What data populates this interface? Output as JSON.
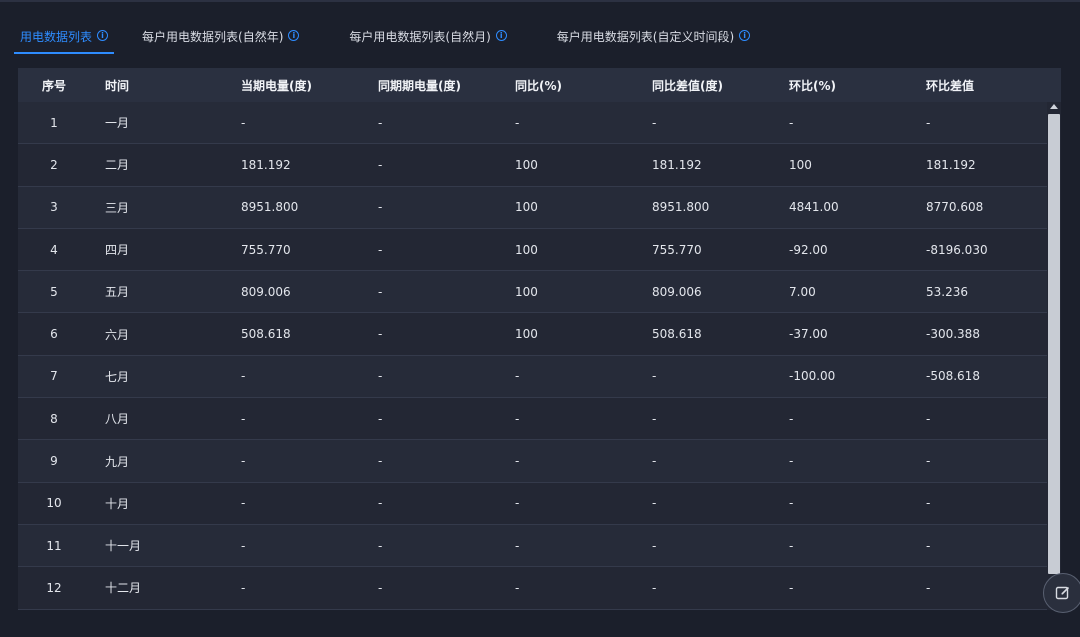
{
  "tabs": [
    {
      "label": "用电数据列表",
      "active": true
    },
    {
      "label": "每户用电数据列表(自然年)",
      "active": false
    },
    {
      "label": "每户用电数据列表(自然月)",
      "active": false
    },
    {
      "label": "每户用电数据列表(自定义时间段)",
      "active": false
    }
  ],
  "table": {
    "columns": [
      "序号",
      "时间",
      "当期电量(度)",
      "同期期电量(度)",
      "同比(%)",
      "同比差值(度)",
      "环比(%)",
      "环比差值"
    ],
    "rows": [
      [
        "1",
        "一月",
        "-",
        "-",
        "-",
        "-",
        "-",
        "-"
      ],
      [
        "2",
        "二月",
        "181.192",
        "-",
        "100",
        "181.192",
        "100",
        "181.192"
      ],
      [
        "3",
        "三月",
        "8951.800",
        "-",
        "100",
        "8951.800",
        "4841.00",
        "8770.608"
      ],
      [
        "4",
        "四月",
        "755.770",
        "-",
        "100",
        "755.770",
        "-92.00",
        "-8196.030"
      ],
      [
        "5",
        "五月",
        "809.006",
        "-",
        "100",
        "809.006",
        "7.00",
        "53.236"
      ],
      [
        "6",
        "六月",
        "508.618",
        "-",
        "100",
        "508.618",
        "-37.00",
        "-300.388"
      ],
      [
        "7",
        "七月",
        "-",
        "-",
        "-",
        "-",
        "-100.00",
        "-508.618"
      ],
      [
        "8",
        "八月",
        "-",
        "-",
        "-",
        "-",
        "-",
        "-"
      ],
      [
        "9",
        "九月",
        "-",
        "-",
        "-",
        "-",
        "-",
        "-"
      ],
      [
        "10",
        "十月",
        "-",
        "-",
        "-",
        "-",
        "-",
        "-"
      ],
      [
        "11",
        "十一月",
        "-",
        "-",
        "-",
        "-",
        "-",
        "-"
      ],
      [
        "12",
        "十二月",
        "-",
        "-",
        "-",
        "-",
        "-",
        "-"
      ]
    ]
  },
  "colors": {
    "accent": "#2e8cff",
    "background": "#1b1f2b",
    "header": "#2a3040"
  },
  "icons": {
    "tab_info": "info-circle-icon",
    "edit": "edit-icon"
  }
}
